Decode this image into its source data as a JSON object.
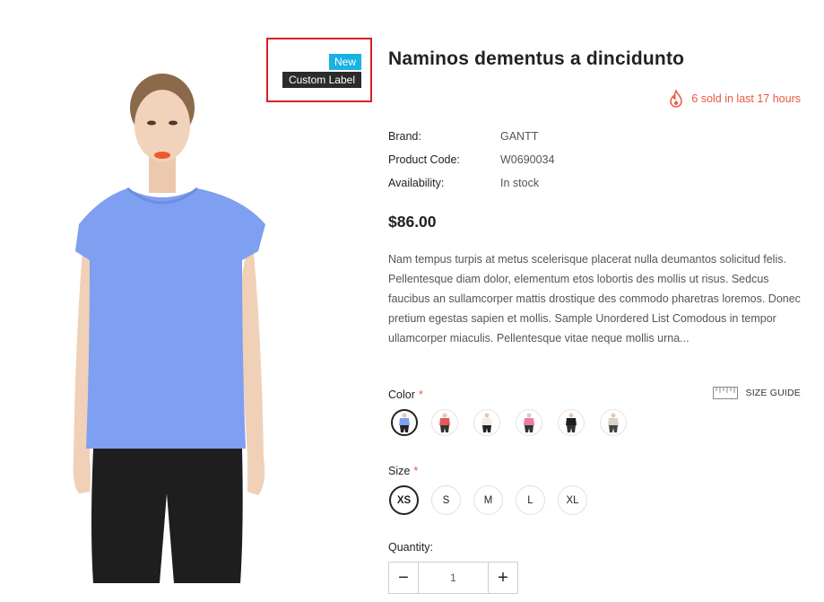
{
  "product": {
    "title": "Naminos dementus a dincidunto",
    "badge_new": "New",
    "badge_custom": "Custom Label",
    "sold_notice": "6 sold in last 17 hours",
    "price": "$86.00",
    "info": [
      {
        "label": "Brand:",
        "value": "GANTT"
      },
      {
        "label": "Product Code:",
        "value": "W0690034"
      },
      {
        "label": "Availability:",
        "value": "In stock"
      }
    ],
    "description": "Nam tempus turpis at metus scelerisque placerat nulla deumantos solicitud felis. Pellentesque diam dolor, elementum etos lobortis des mollis ut risus. Sedcus faucibus an sullamcorper mattis drostique des commodo pharetras loremos. Donec pretium egestas sapien et mollis. Sample Unordered List Comodous in tempor ullamcorper miaculis. Pellentesque vitae neque mollis urna..."
  },
  "options": {
    "color_label": "Color",
    "required_mark": "*",
    "size_guide_label": "SIZE GUIDE",
    "colors": [
      {
        "shirt": "#7f9ff0",
        "pants": "#222222",
        "selected": true
      },
      {
        "shirt": "#e35a5a",
        "pants": "#333333",
        "selected": false
      },
      {
        "shirt": "#f3ede6",
        "pants": "#222222",
        "selected": false
      },
      {
        "shirt": "#ea7fa4",
        "pants": "#333333",
        "selected": false
      },
      {
        "shirt": "#1e1e1e",
        "pants": "#333333",
        "selected": false
      },
      {
        "shirt": "#d8d2cc",
        "pants": "#444444",
        "selected": false
      }
    ],
    "size_label": "Size",
    "sizes": [
      "XS",
      "S",
      "M",
      "L",
      "XL"
    ],
    "selected_size": "XS",
    "quantity_label": "Quantity:",
    "quantity_minus": "−",
    "quantity_value": "1",
    "quantity_plus": "+"
  },
  "colors": {
    "accent_red": "#e9573f",
    "badge_new_bg": "#1ab1e3",
    "badge_custom_bg": "#2b2b2b",
    "highlight_box": "#d62027",
    "product_shirt": "#7f9ff0"
  }
}
